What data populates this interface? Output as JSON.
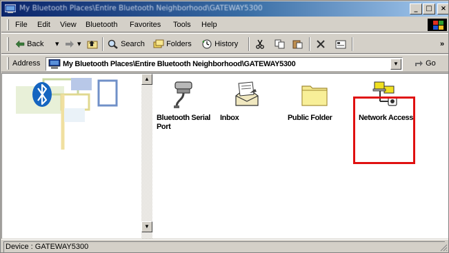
{
  "window": {
    "title": "My Bluetooth Places\\Entire Bluetooth Neighborhood\\GATEWAY5300",
    "buttons": {
      "minimize": "_",
      "maximize": "□",
      "close": "×"
    }
  },
  "menu": {
    "items": [
      {
        "label": "File"
      },
      {
        "label": "Edit"
      },
      {
        "label": "View"
      },
      {
        "label": "Bluetooth"
      },
      {
        "label": "Favorites"
      },
      {
        "label": "Tools"
      },
      {
        "label": "Help"
      }
    ]
  },
  "toolbar": {
    "back": "Back",
    "search": "Search",
    "folders": "Folders",
    "history": "History",
    "overflow": "»"
  },
  "address": {
    "label": "Address",
    "value": "My Bluetooth Places\\Entire Bluetooth Neighborhood\\GATEWAY5300",
    "go": "Go"
  },
  "items": [
    {
      "label": "Bluetooth Serial Port",
      "icon": "serial-port-icon"
    },
    {
      "label": "Inbox",
      "icon": "inbox-icon"
    },
    {
      "label": "Public Folder",
      "icon": "folder-icon"
    },
    {
      "label": "Network Access",
      "icon": "network-access-icon"
    }
  ],
  "status": {
    "text": "Device : GATEWAY5300"
  },
  "colors": {
    "title_start": "#0a246a",
    "title_end": "#a6caf0",
    "window_face": "#d4d0c8",
    "highlight": "#e01010",
    "bluetooth_blue": "#1565c0"
  }
}
